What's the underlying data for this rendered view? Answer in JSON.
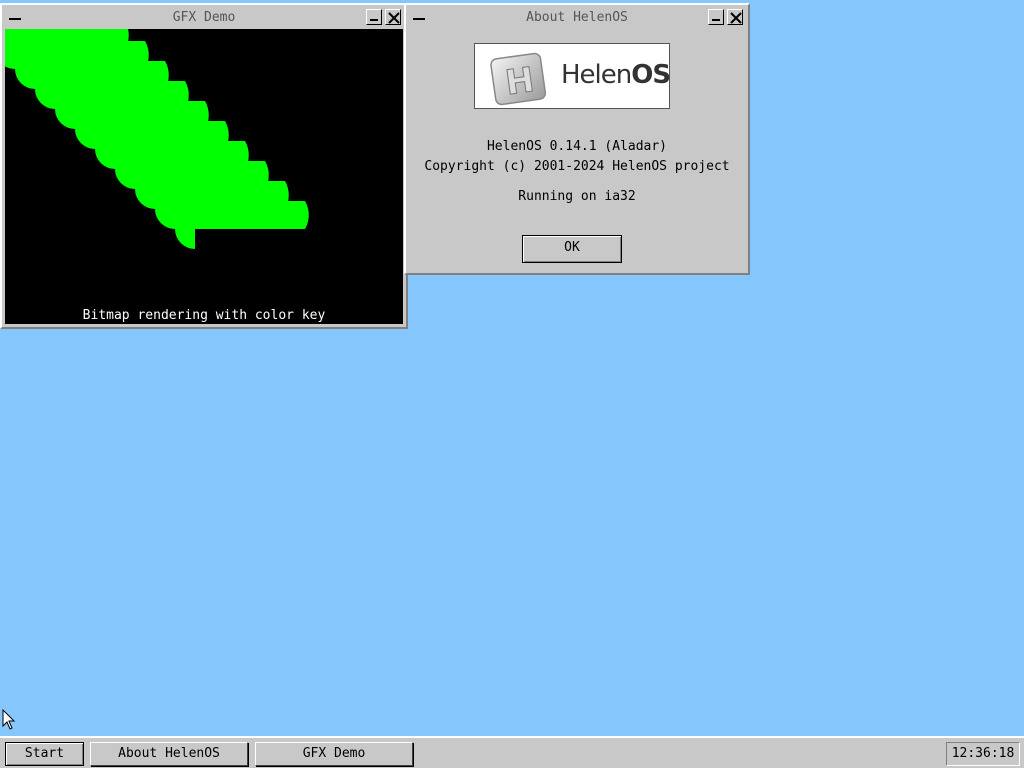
{
  "gfx_window": {
    "title": "GFX Demo",
    "caption": "Bitmap rendering with color key"
  },
  "about_window": {
    "title": "About HelenOS",
    "logo_text": "HelenOS",
    "version": "HelenOS 0.14.1 (Aladar)",
    "copyright": "Copyright (c) 2001-2024 HelenOS project",
    "platform": "Running on ia32",
    "ok_label": "OK"
  },
  "taskbar": {
    "start_label": "Start",
    "tasks": [
      "About HelenOS",
      "GFX Demo"
    ],
    "clock": "12:36:18"
  },
  "colors": {
    "desktop": "#85c6fd",
    "bitmap": "#00ff00"
  },
  "icons": {
    "window_menu": "minus-icon",
    "minimize": "minimize-icon",
    "close": "close-icon",
    "pointer": "mouse-pointer-icon",
    "logo": "helenos-logo-icon"
  }
}
